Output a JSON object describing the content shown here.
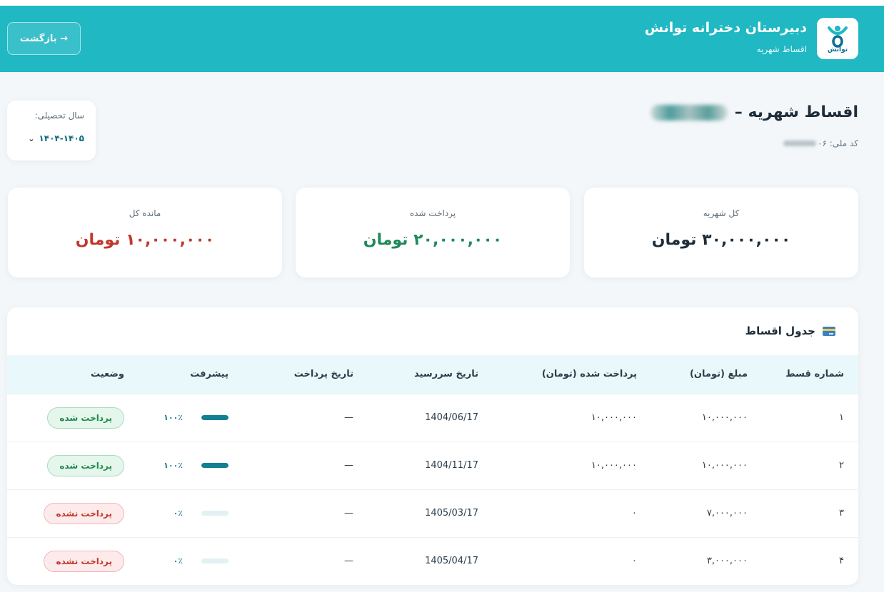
{
  "header": {
    "school_name": "دبیرستان دخترانه توانش",
    "subtitle": "اقساط شهریه",
    "logo_text": "توانش",
    "back_label": "→ بازگشت"
  },
  "page": {
    "title": "اقساط شهریه –",
    "national_id_label": "کد ملی: ۰۶"
  },
  "year_selector": {
    "label": "سال تحصیلی:",
    "value": "۱۴۰۴-۱۴۰۵",
    "icon": "chevron-down-icon"
  },
  "summary": [
    {
      "label": "کل شهریه",
      "value": "۳۰,۰۰۰,۰۰۰ تومان",
      "color": "#1f2d3a"
    },
    {
      "label": "پرداخت شده",
      "value": "۲۰,۰۰۰,۰۰۰ تومان",
      "color": "#1f8a5a"
    },
    {
      "label": "مانده کل",
      "value": "۱۰,۰۰۰,۰۰۰ تومان",
      "color": "#c0392b"
    }
  ],
  "table": {
    "title": "جدول اقساط",
    "icon": "credit-card-icon",
    "columns": [
      "شماره قسط",
      "مبلغ (تومان)",
      "پرداخت شده (تومان)",
      "تاریخ سررسید",
      "تاریخ پرداخت",
      "پیشرفت",
      "وضعیت"
    ],
    "rows": [
      {
        "number": "۱",
        "amount": "۱۰,۰۰۰,۰۰۰",
        "paid": "۱۰,۰۰۰,۰۰۰",
        "due": "1404/06/17",
        "paid_date": "—",
        "progress": 1.0,
        "progress_label": "۱۰۰٪",
        "status": "پرداخت شده",
        "status_type": "paid"
      },
      {
        "number": "۲",
        "amount": "۱۰,۰۰۰,۰۰۰",
        "paid": "۱۰,۰۰۰,۰۰۰",
        "due": "1404/11/17",
        "paid_date": "—",
        "progress": 1.0,
        "progress_label": "۱۰۰٪",
        "status": "پرداخت شده",
        "status_type": "paid"
      },
      {
        "number": "۳",
        "amount": "۷,۰۰۰,۰۰۰",
        "paid": "۰",
        "due": "1405/03/17",
        "paid_date": "—",
        "progress": 0.0,
        "progress_label": "۰٪",
        "status": "پرداخت نشده",
        "status_type": "unpaid"
      },
      {
        "number": "۴",
        "amount": "۳,۰۰۰,۰۰۰",
        "paid": "۰",
        "due": "1405/04/17",
        "paid_date": "—",
        "progress": 0.0,
        "progress_label": "۰٪",
        "status": "پرداخت نشده",
        "status_type": "unpaid"
      }
    ]
  }
}
